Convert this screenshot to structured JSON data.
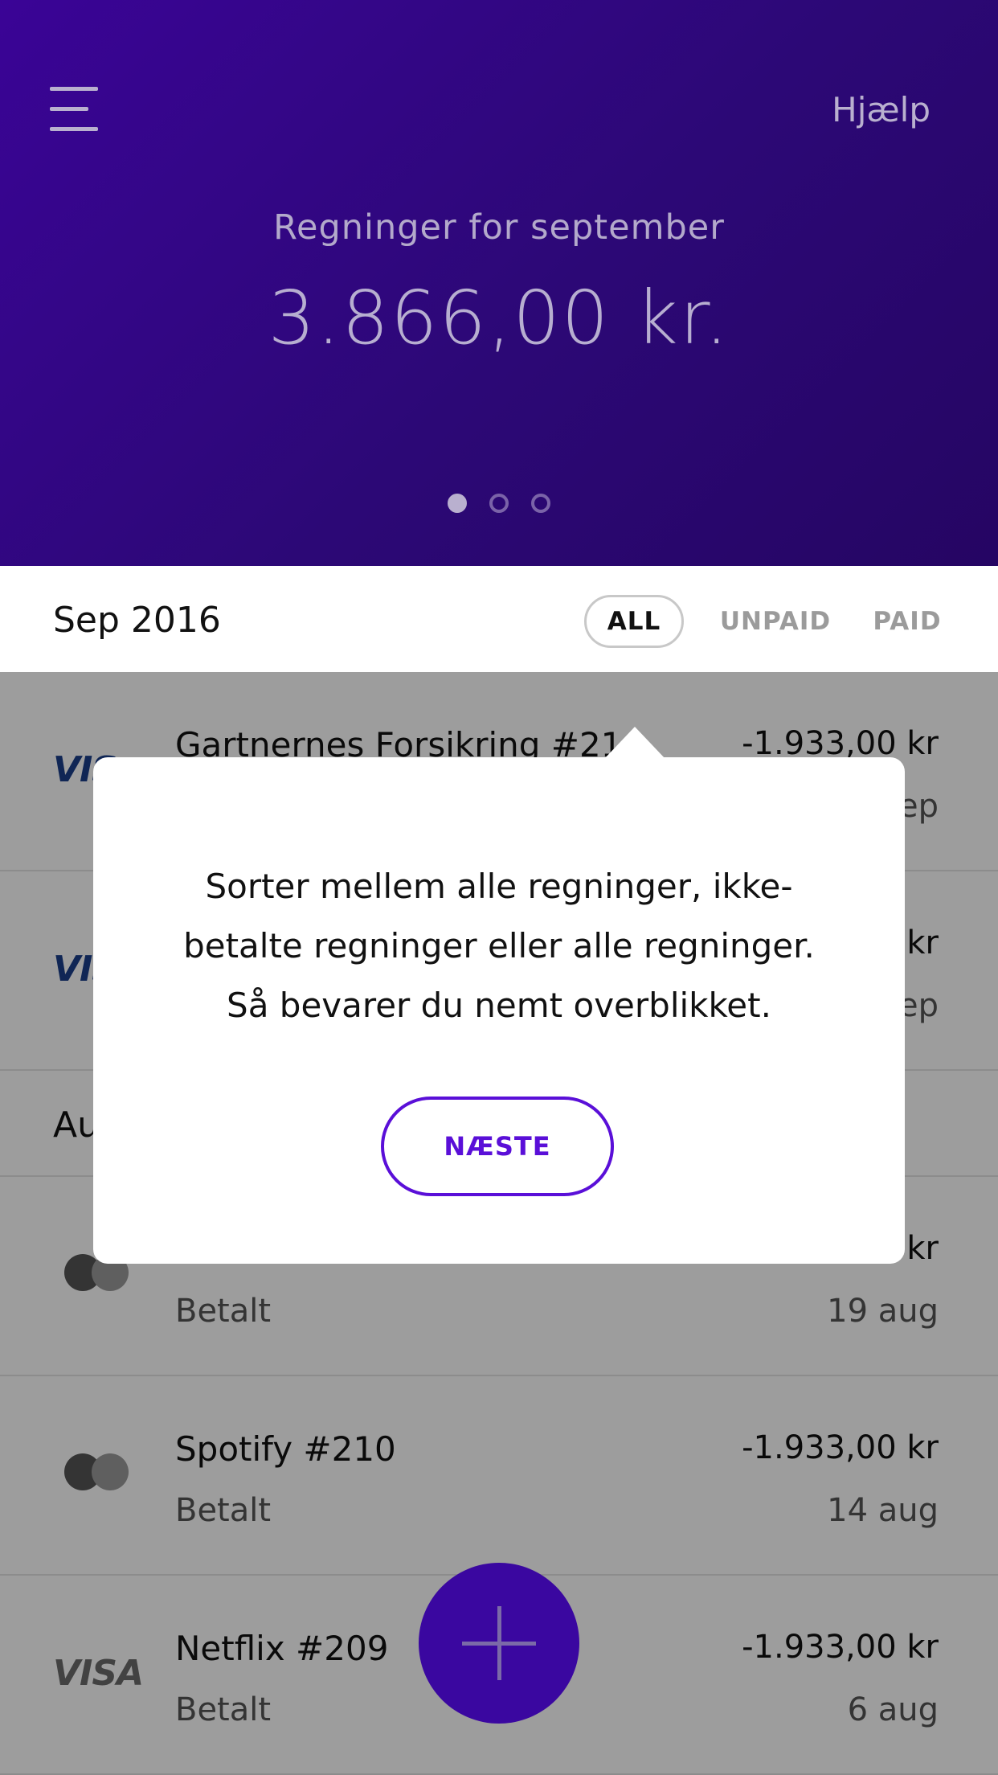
{
  "header": {
    "help_label": "Hjælp",
    "subtitle": "Regninger for september",
    "amount": "3.866,00 kr."
  },
  "filter": {
    "month": "Sep 2016",
    "tabs": [
      "ALL",
      "UNPAID",
      "PAID"
    ],
    "selected": "ALL"
  },
  "sections": [
    {
      "label": "Sep 2016",
      "bills": [
        {
          "logo": "visa",
          "title": "Gartnernes Forsikring #21",
          "status": "",
          "amount": "-1.933,00 kr",
          "date": "ep"
        },
        {
          "logo": "visa",
          "title": "",
          "status": "",
          "amount": "kr",
          "date": "ep"
        }
      ]
    },
    {
      "label": "Au",
      "bills": [
        {
          "logo": "mastercard",
          "title": "",
          "status": "Betalt",
          "amount": "kr",
          "date": "19 aug"
        },
        {
          "logo": "mastercard",
          "title": "Spotify #210",
          "status": "Betalt",
          "amount": "-1.933,00 kr",
          "date": "14 aug"
        },
        {
          "logo": "visa",
          "title": "Netflix #209",
          "status": "Betalt",
          "amount": "-1.933,00 kr",
          "date": "6 aug"
        }
      ]
    }
  ],
  "brand": {
    "visa_text": "VISA",
    "visa_partial": "VIS"
  },
  "tooltip": {
    "line1": "Sorter mellem alle regninger, ikke-",
    "line2": "betalte regninger eller alle regninger.",
    "line3": "Så bevarer du nemt overblikket.",
    "button_label": "NÆSTE"
  },
  "colors": {
    "header_start": "#3a0496",
    "header_end": "#250563",
    "accent": "#5a0fd8",
    "fab": "#3a07a0"
  },
  "icons": {
    "menu": "hamburger-menu-icon",
    "fab": "plus-icon"
  }
}
